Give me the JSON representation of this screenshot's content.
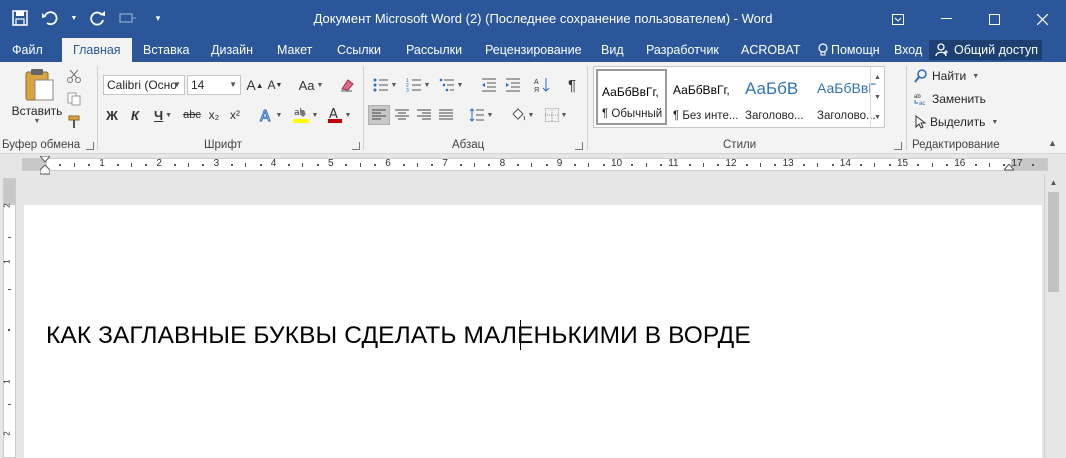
{
  "window": {
    "title": "Документ Microsoft Word (2) (Последнее сохранение пользователем) - Word"
  },
  "quick_access": [
    {
      "icon": "save-icon"
    },
    {
      "icon": "undo-icon"
    },
    {
      "icon": "redo-icon"
    },
    {
      "icon": "quick-access-more-icon"
    }
  ],
  "tabs": [
    {
      "label": "Файл"
    },
    {
      "label": "Главная"
    },
    {
      "label": "Вставка"
    },
    {
      "label": "Дизайн"
    },
    {
      "label": "Макет"
    },
    {
      "label": "Ссылки"
    },
    {
      "label": "Рассылки"
    },
    {
      "label": "Рецензирование"
    },
    {
      "label": "Вид"
    },
    {
      "label": "Разработчик"
    },
    {
      "label": "ACROBAT"
    },
    {
      "label": "Помощн"
    },
    {
      "label": "Вход"
    }
  ],
  "share_label": "Общий доступ",
  "clipboard": {
    "paste_label": "Вставить",
    "group_label": "Буфер обмена"
  },
  "font": {
    "name": "Calibri (Осно",
    "size": "14",
    "bold": "Ж",
    "italic": "К",
    "underline": "Ч",
    "strike": "abc",
    "subscript": "x₂",
    "superscript": "x²",
    "grow": "A",
    "shrink": "A",
    "case": "Aa",
    "group_label": "Шрифт",
    "highlight_color": "#ffff00",
    "font_color": "#c00000"
  },
  "paragraph": {
    "pilcrow": "¶",
    "group_label": "Абзац"
  },
  "styles": {
    "items": [
      {
        "sample": "АаБбВвГг,",
        "name": "¶ Обычный"
      },
      {
        "sample": "АаБбВвГг,",
        "name": "¶ Без инте..."
      },
      {
        "sample": "АаБбВ",
        "name": "Заголово..."
      },
      {
        "sample": "АаБбВвГ",
        "name": "Заголово..."
      }
    ],
    "group_label": "Стили"
  },
  "editing": {
    "find": "Найти",
    "replace": "Заменить",
    "select": "Выделить",
    "group_label": "Редактирование"
  },
  "ruler": {
    "left": [
      "2",
      "1"
    ],
    "right": [
      "1",
      "2",
      "3",
      "4",
      "5",
      "6",
      "7",
      "8",
      "9",
      "10",
      "11",
      "12",
      "13",
      "14",
      "15",
      "16",
      "17"
    ]
  },
  "document": {
    "text": "КАК ЗАГЛАВНЫЕ БУКВЫ СДЕЛАТЬ МАЛЕНЬКИМИ В ВОРДЕ"
  },
  "colors": {
    "accent": "#2b579a",
    "ribbon": "#f3f3f3"
  }
}
